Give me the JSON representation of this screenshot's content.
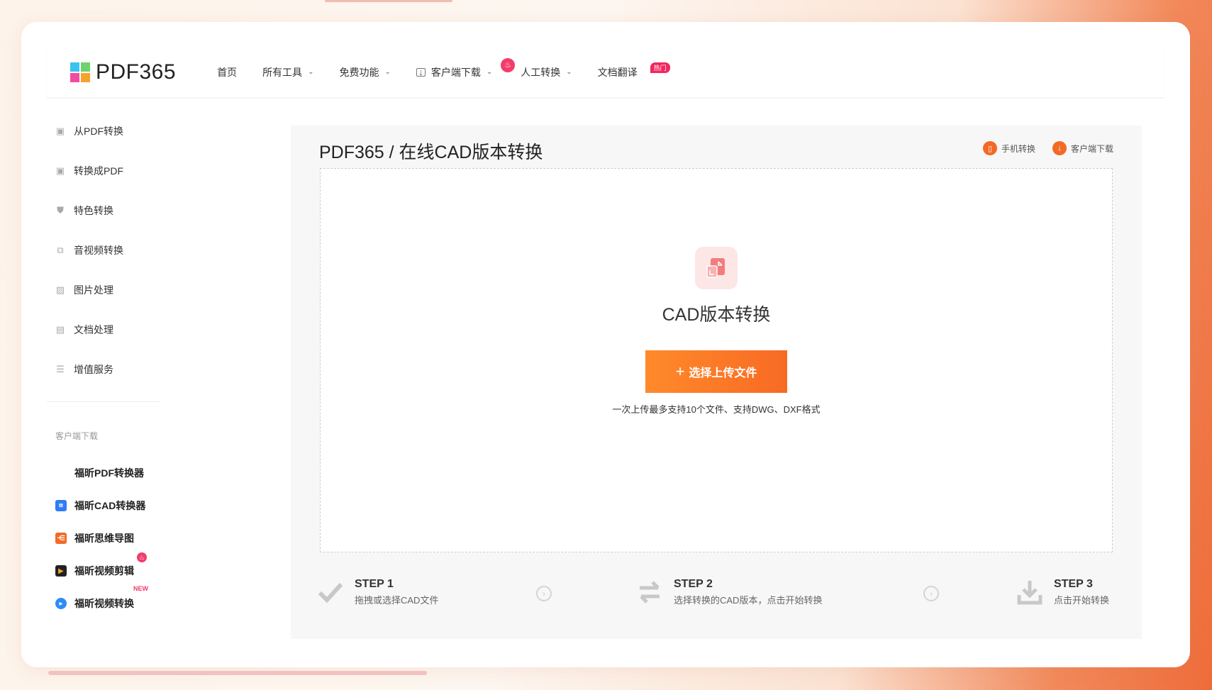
{
  "header": {
    "logo_text": "PDF365",
    "nav": {
      "home": "首页",
      "all_tools": "所有工具",
      "free_features": "免费功能",
      "client_download": "客户端下载",
      "manual_convert": "人工转换",
      "doc_translate": "文档翻译",
      "hot_badge": "热门"
    }
  },
  "sidebar": {
    "items": [
      {
        "label": "从PDF转换",
        "icon": "pdf-from-icon"
      },
      {
        "label": "转换成PDF",
        "icon": "pdf-to-icon"
      },
      {
        "label": "特色转换",
        "icon": "star-shield-icon"
      },
      {
        "label": "音视频转换",
        "icon": "media-icon"
      },
      {
        "label": "图片处理",
        "icon": "image-icon"
      },
      {
        "label": "文档处理",
        "icon": "document-icon"
      },
      {
        "label": "增值服务",
        "icon": "list-icon"
      }
    ],
    "section_title": "客户端下载",
    "apps": [
      {
        "label": "福昕PDF转换器",
        "color": "#39c3f0"
      },
      {
        "label": "福昕CAD转换器",
        "color": "#2f7cf6"
      },
      {
        "label": "福昕思维导图",
        "color": "#f36a26"
      },
      {
        "label": "福昕视频剪辑",
        "color": "#222222"
      },
      {
        "label": "福昕视频转换",
        "color": "#2f8cf6"
      }
    ],
    "new_badge": "NEW"
  },
  "main": {
    "title": "PDF365 / 在线CAD版本转换",
    "mobile_convert": "手机转换",
    "client_download": "客户端下载",
    "drop_title": "CAD版本转换",
    "upload_button": "选择上传文件",
    "hint": "一次上传最多支持10个文件、支持DWG、DXF格式"
  },
  "steps": [
    {
      "title": "STEP 1",
      "desc": "拖拽或选择CAD文件"
    },
    {
      "title": "STEP 2",
      "desc": "选择转换的CAD版本，点击开始转换"
    },
    {
      "title": "STEP 3",
      "desc": "点击开始转换"
    }
  ],
  "colors": {
    "accent": "#f86a24",
    "hot": "#f2275e"
  }
}
